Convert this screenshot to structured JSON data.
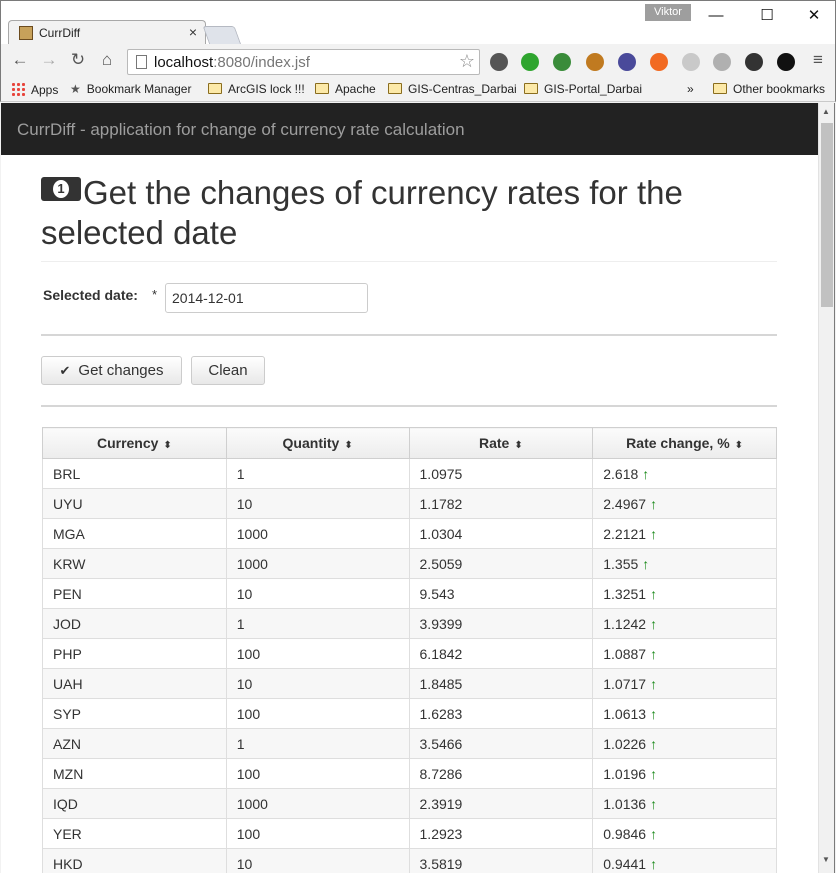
{
  "browser": {
    "tab_title": "CurrDiff",
    "tab_close": "×",
    "user": "Viktor",
    "window_buttons": {
      "minimize": "—",
      "maximize": "☐",
      "close": "✕"
    },
    "url_host": "localhost",
    "url_path": ":8080/index.jsf",
    "nav": {
      "back": "←",
      "forward": "→",
      "reload": "↻",
      "home": "⌂",
      "menu": "≡",
      "star": "☆"
    },
    "extension_colors": [
      "#555555",
      "#2fa52f",
      "#3a8c3a",
      "#c07a20",
      "#4a4a9a",
      "#f26a22",
      "#c9c9c9",
      "#b0b0b0",
      "#333333",
      "#111111"
    ],
    "bookmarks": {
      "apps": "Apps",
      "bookmark_manager": "Bookmark Manager",
      "items": [
        "ArcGIS lock !!!",
        "Apache",
        "GIS-Centras_Darbai",
        "GIS-Portal_Darbai"
      ],
      "overflow": "»",
      "other": "Other bookmarks"
    }
  },
  "app": {
    "brand": "CurrDiff - application for change of currency rate calculation",
    "heading": "Get the changes of currency rates for the selected date",
    "money_icon_glyph": "1",
    "date_label": "Selected date:",
    "required_mark": "*",
    "date_value": "2014-12-01",
    "get_changes_label": "Get changes",
    "clean_label": "Clean",
    "check_glyph": "✔",
    "sort_glyph": "⬍",
    "up_arrow": "↑"
  },
  "table": {
    "columns": [
      "Currency",
      "Quantity",
      "Rate",
      "Rate change, %"
    ],
    "rows": [
      [
        "BRL",
        "1",
        "1.0975",
        "2.618"
      ],
      [
        "UYU",
        "10",
        "1.1782",
        "2.4967"
      ],
      [
        "MGA",
        "1000",
        "1.0304",
        "2.2121"
      ],
      [
        "KRW",
        "1000",
        "2.5059",
        "1.355"
      ],
      [
        "PEN",
        "10",
        "9.543",
        "1.3251"
      ],
      [
        "JOD",
        "1",
        "3.9399",
        "1.1242"
      ],
      [
        "PHP",
        "100",
        "6.1842",
        "1.0887"
      ],
      [
        "UAH",
        "10",
        "1.8485",
        "1.0717"
      ],
      [
        "SYP",
        "100",
        "1.6283",
        "1.0613"
      ],
      [
        "AZN",
        "1",
        "3.5466",
        "1.0226"
      ],
      [
        "MZN",
        "100",
        "8.7286",
        "1.0196"
      ],
      [
        "IQD",
        "1000",
        "2.3919",
        "1.0136"
      ],
      [
        "YER",
        "100",
        "1.2923",
        "0.9846"
      ],
      [
        "HKD",
        "10",
        "3.5819",
        "0.9441"
      ]
    ]
  }
}
